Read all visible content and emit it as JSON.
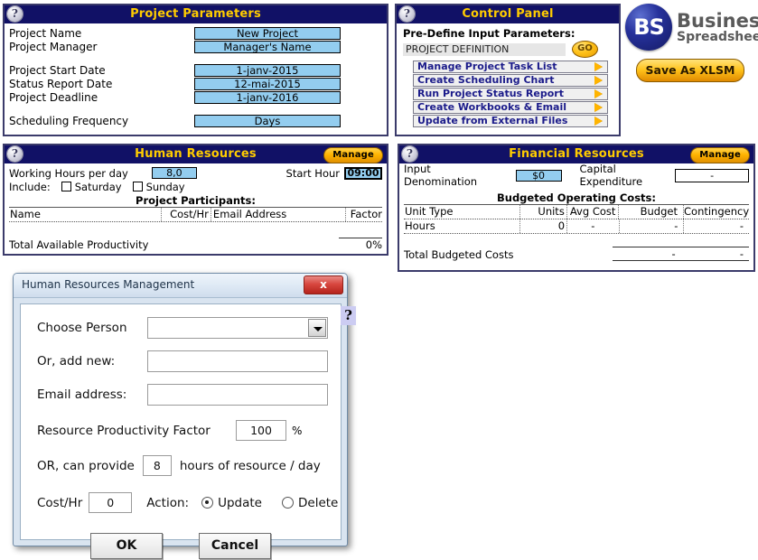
{
  "project_parameters": {
    "title": "Project Parameters",
    "help_icon": "question-mark-icon",
    "rows": [
      {
        "label": "Project Name",
        "value": "New Project"
      },
      {
        "label": "Project Manager",
        "value": "Manager's Name"
      },
      {
        "label": "Project Start Date",
        "value": "1-janv-2015"
      },
      {
        "label": "Status Report Date",
        "value": "12-mai-2015"
      },
      {
        "label": "Project Deadline",
        "value": "1-janv-2016"
      },
      {
        "label": "Scheduling Frequency",
        "value": "Days"
      }
    ]
  },
  "control_panel": {
    "title": "Control Panel",
    "predefine_label": "Pre-Define Input Parameters:",
    "predefine_value": "PROJECT DEFINITION",
    "go_label": "GO",
    "items": [
      {
        "label": "Manage Project Task List"
      },
      {
        "label": "Create Scheduling Chart"
      },
      {
        "label": "Run Project Status Report"
      },
      {
        "label": "Create Workbooks & Email"
      },
      {
        "label": "Update from External Files"
      }
    ]
  },
  "brand": {
    "mark_text": "BS",
    "name_line1": "Business",
    "name_line2": "Spreadsheets",
    "save_button": "Save As  XLSM"
  },
  "human_resources": {
    "title": "Human Resources",
    "manage_label": "Manage",
    "working_hours_label": "Working Hours per day",
    "working_hours_value": "8,0",
    "start_hour_label": "Start Hour",
    "start_hour_value": "09:00",
    "include_label": "Include:",
    "saturday_label": "Saturday",
    "sunday_label": "Sunday",
    "participants_caption": "Project Participants:",
    "columns": [
      "Name",
      "Cost/Hr",
      "Email Address",
      "Factor"
    ],
    "rows": [],
    "total_label": "Total Available Productivity",
    "total_value": "0%"
  },
  "financial_resources": {
    "title": "Financial Resources",
    "manage_label": "Manage",
    "denomination_label": "Input Denomination",
    "denomination_value": "$0",
    "capex_label": "Capital Expenditure",
    "capex_value": "-",
    "budget_caption": "Budgeted Operating Costs:",
    "columns": [
      "Unit Type",
      "Units",
      "Avg Cost",
      "Budget",
      "Contingency"
    ],
    "rows": [
      {
        "unit_type": "Hours",
        "units": "0",
        "avg_cost": "-",
        "budget": "-",
        "contingency": "-"
      }
    ],
    "total_label": "Total Budgeted Costs",
    "total_budget": "-",
    "total_contingency": "-"
  },
  "dialog": {
    "title": "Human Resources Management",
    "close_label": "x",
    "help_label": "?",
    "choose_person_label": "Choose Person",
    "choose_person_value": "",
    "add_new_label": "Or, add new:",
    "add_new_value": "",
    "email_label": "Email address:",
    "email_value": "",
    "productivity_label": "Resource Productivity Factor",
    "productivity_value": "100",
    "percent_symbol": "%",
    "or_provide_label": "OR, can provide",
    "or_provide_value": "8",
    "or_provide_suffix": "hours of resource / day",
    "cost_label": "Cost/Hr",
    "cost_value": "0",
    "action_label": "Action:",
    "update_label": "Update",
    "delete_label": "Delete",
    "selected_action": "Update",
    "ok_label": "OK",
    "cancel_label": "Cancel"
  }
}
